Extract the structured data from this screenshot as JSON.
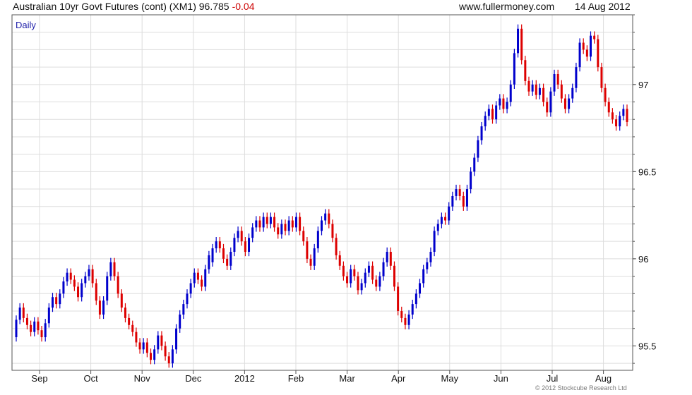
{
  "header": {
    "title": "Australian 10yr Govt Futures (cont) (XM1)",
    "price": "96.785",
    "change": "-0.04",
    "site": "www.fullermoney.com",
    "date": "14 Aug 2012"
  },
  "footer": {
    "copyright": "© 2012 Stockcube Research Ltd"
  },
  "colors": {
    "up": "#0000cc",
    "down": "#dd0000",
    "grid": "#dddddd",
    "axis": "#555555",
    "label_blue": "#2222aa"
  },
  "chart_data": {
    "type": "candlestick",
    "interval_label": "Daily",
    "x_tick_labels": [
      "Sep",
      "Oct",
      "Nov",
      "Dec",
      "2012",
      "Feb",
      "Mar",
      "Apr",
      "May",
      "Jun",
      "Jul",
      "Aug"
    ],
    "y_tick_labels": [
      "95.5",
      "96",
      "96.5",
      "97"
    ],
    "y_ticks": [
      95.5,
      96.0,
      96.5,
      97.0
    ],
    "ylim": [
      95.36,
      97.4
    ],
    "grid": true,
    "series": [
      {
        "name": "",
        "values": [
          [
            95.55,
            95.65
          ],
          [
            95.65,
            95.72
          ],
          [
            95.72,
            95.66
          ],
          [
            95.66,
            95.62
          ],
          [
            95.62,
            95.58
          ],
          [
            95.58,
            95.64
          ],
          [
            95.64,
            95.59
          ],
          [
            95.59,
            95.55
          ],
          [
            95.55,
            95.63
          ],
          [
            95.63,
            95.72
          ],
          [
            95.72,
            95.78
          ],
          [
            95.78,
            95.74
          ],
          [
            95.74,
            95.8
          ],
          [
            95.8,
            95.87
          ],
          [
            95.87,
            95.92
          ],
          [
            95.92,
            95.88
          ],
          [
            95.88,
            95.84
          ],
          [
            95.84,
            95.78
          ],
          [
            95.78,
            95.86
          ],
          [
            95.86,
            95.9
          ],
          [
            95.9,
            95.94
          ],
          [
            95.94,
            95.86
          ],
          [
            95.86,
            95.76
          ],
          [
            95.76,
            95.68
          ],
          [
            95.68,
            95.76
          ],
          [
            95.76,
            95.9
          ],
          [
            95.9,
            95.98
          ],
          [
            95.98,
            95.9
          ],
          [
            95.9,
            95.8
          ],
          [
            95.8,
            95.72
          ],
          [
            95.72,
            95.66
          ],
          [
            95.66,
            95.62
          ],
          [
            95.62,
            95.58
          ],
          [
            95.58,
            95.52
          ],
          [
            95.52,
            95.48
          ],
          [
            95.48,
            95.52
          ],
          [
            95.52,
            95.46
          ],
          [
            95.46,
            95.42
          ],
          [
            95.42,
            95.48
          ],
          [
            95.48,
            95.56
          ],
          [
            95.56,
            95.5
          ],
          [
            95.5,
            95.44
          ],
          [
            95.44,
            95.4
          ],
          [
            95.4,
            95.48
          ],
          [
            95.48,
            95.6
          ],
          [
            95.6,
            95.68
          ],
          [
            95.68,
            95.74
          ],
          [
            95.74,
            95.8
          ],
          [
            95.8,
            95.86
          ],
          [
            95.86,
            95.92
          ],
          [
            95.92,
            95.88
          ],
          [
            95.88,
            95.84
          ],
          [
            95.84,
            95.94
          ],
          [
            95.94,
            96.02
          ],
          [
            95.98,
            96.06
          ],
          [
            96.06,
            96.1
          ],
          [
            96.1,
            96.06
          ],
          [
            96.06,
            96.0
          ],
          [
            96.0,
            95.96
          ],
          [
            95.96,
            96.04
          ],
          [
            96.04,
            96.12
          ],
          [
            96.12,
            96.16
          ],
          [
            96.16,
            96.1
          ],
          [
            96.1,
            96.04
          ],
          [
            96.04,
            96.12
          ],
          [
            96.12,
            96.18
          ],
          [
            96.18,
            96.22
          ],
          [
            96.22,
            96.18
          ],
          [
            96.18,
            96.24
          ],
          [
            96.24,
            96.2
          ],
          [
            96.2,
            96.24
          ],
          [
            96.24,
            96.18
          ],
          [
            96.18,
            96.14
          ],
          [
            96.14,
            96.2
          ],
          [
            96.2,
            96.16
          ],
          [
            96.16,
            96.22
          ],
          [
            96.22,
            96.18
          ],
          [
            96.18,
            96.24
          ],
          [
            96.24,
            96.16
          ],
          [
            96.16,
            96.1
          ],
          [
            96.1,
            96.0
          ],
          [
            96.0,
            95.96
          ],
          [
            95.96,
            96.06
          ],
          [
            96.06,
            96.16
          ],
          [
            96.16,
            96.22
          ],
          [
            96.22,
            96.26
          ],
          [
            96.26,
            96.2
          ],
          [
            96.2,
            96.12
          ],
          [
            96.12,
            96.02
          ],
          [
            96.02,
            95.96
          ],
          [
            95.96,
            95.9
          ],
          [
            95.9,
            95.86
          ],
          [
            95.86,
            95.94
          ],
          [
            95.94,
            95.9
          ],
          [
            95.9,
            95.82
          ],
          [
            95.82,
            95.86
          ],
          [
            95.86,
            95.92
          ],
          [
            95.92,
            95.96
          ],
          [
            95.96,
            95.88
          ],
          [
            95.88,
            95.84
          ],
          [
            95.84,
            95.9
          ],
          [
            95.9,
            95.98
          ],
          [
            95.98,
            96.04
          ],
          [
            96.04,
            95.96
          ],
          [
            95.96,
            95.84
          ],
          [
            95.84,
            95.7
          ],
          [
            95.7,
            95.66
          ],
          [
            95.66,
            95.62
          ],
          [
            95.62,
            95.68
          ],
          [
            95.68,
            95.74
          ],
          [
            95.74,
            95.8
          ],
          [
            95.8,
            95.86
          ],
          [
            95.86,
            95.94
          ],
          [
            95.94,
            95.98
          ],
          [
            95.98,
            96.04
          ],
          [
            96.04,
            96.16
          ],
          [
            96.16,
            96.2
          ],
          [
            96.2,
            96.24
          ],
          [
            96.24,
            96.22
          ],
          [
            96.22,
            96.3
          ],
          [
            96.3,
            96.36
          ],
          [
            96.36,
            96.4
          ],
          [
            96.4,
            96.36
          ],
          [
            96.36,
            96.3
          ],
          [
            96.3,
            96.4
          ],
          [
            96.4,
            96.5
          ],
          [
            96.5,
            96.58
          ],
          [
            96.58,
            96.68
          ],
          [
            96.68,
            96.76
          ],
          [
            96.76,
            96.82
          ],
          [
            96.82,
            96.86
          ],
          [
            96.86,
            96.8
          ],
          [
            96.8,
            96.88
          ],
          [
            96.88,
            96.92
          ],
          [
            96.92,
            96.86
          ],
          [
            96.86,
            96.9
          ],
          [
            96.9,
            97.0
          ],
          [
            97.0,
            97.18
          ],
          [
            97.18,
            97.32
          ],
          [
            97.32,
            97.14
          ],
          [
            97.14,
            97.02
          ],
          [
            97.02,
            96.96
          ],
          [
            96.96,
            97.0
          ],
          [
            97.0,
            96.94
          ],
          [
            96.94,
            96.98
          ],
          [
            96.98,
            96.9
          ],
          [
            96.9,
            96.84
          ],
          [
            96.84,
            96.96
          ],
          [
            96.96,
            97.06
          ],
          [
            97.06,
            97.0
          ],
          [
            97.0,
            96.92
          ],
          [
            96.92,
            96.86
          ],
          [
            96.86,
            96.92
          ],
          [
            96.92,
            96.98
          ],
          [
            96.98,
            97.1
          ],
          [
            97.1,
            97.24
          ],
          [
            97.24,
            97.2
          ],
          [
            97.2,
            97.16
          ],
          [
            97.16,
            97.28
          ],
          [
            97.28,
            97.26
          ],
          [
            97.26,
            97.1
          ],
          [
            97.1,
            96.98
          ],
          [
            96.98,
            96.9
          ],
          [
            96.9,
            96.84
          ],
          [
            96.84,
            96.8
          ],
          [
            96.8,
            96.76
          ],
          [
            96.76,
            96.82
          ],
          [
            96.82,
            96.86
          ],
          [
            96.86,
            96.785
          ]
        ]
      }
    ]
  }
}
